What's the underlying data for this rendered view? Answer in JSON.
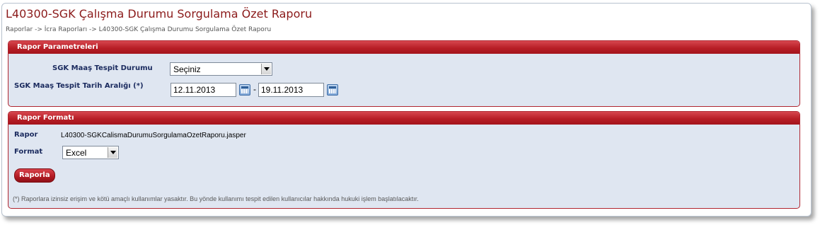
{
  "page": {
    "title": "L40300-SGK Çalışma Durumu Sorgulama Özet Raporu",
    "breadcrumb": "Raporlar -> İcra Raporları -> L40300-SGK Çalışma Durumu Sorgulama Özet Raporu"
  },
  "parameters": {
    "header": "Rapor Parametreleri",
    "status_label": "SGK Maaş Tespit Durumu",
    "status_value": "Seçiniz",
    "date_range_label": "SGK Maaş Tespit Tarih Aralığı (*)",
    "date_from": "12.11.2013",
    "date_separator": "-",
    "date_to": "19.11.2013"
  },
  "format_section": {
    "header": "Rapor Formatı",
    "report_label": "Rapor",
    "report_file": "L40300-SGKCalismaDurumuSorgulamaOzetRaporu.jasper",
    "format_label": "Format",
    "format_value": "Excel",
    "submit_label": "Raporla",
    "footnote": "(*) Raporlara izinsiz erişim ve kötü amaçlı kullanımlar yasaktır. Bu yönde kullanımı tespit edilen kullanıcılar hakkında hukuki işlem başlatılacaktır."
  },
  "icons": {
    "calendar": "calendar-icon",
    "dropdown": "chevron-down-icon"
  },
  "colors": {
    "accent": "#b81e26",
    "panel_bg": "#dfe6f1",
    "title": "#8b1a1a",
    "label": "#1a2a5e"
  }
}
